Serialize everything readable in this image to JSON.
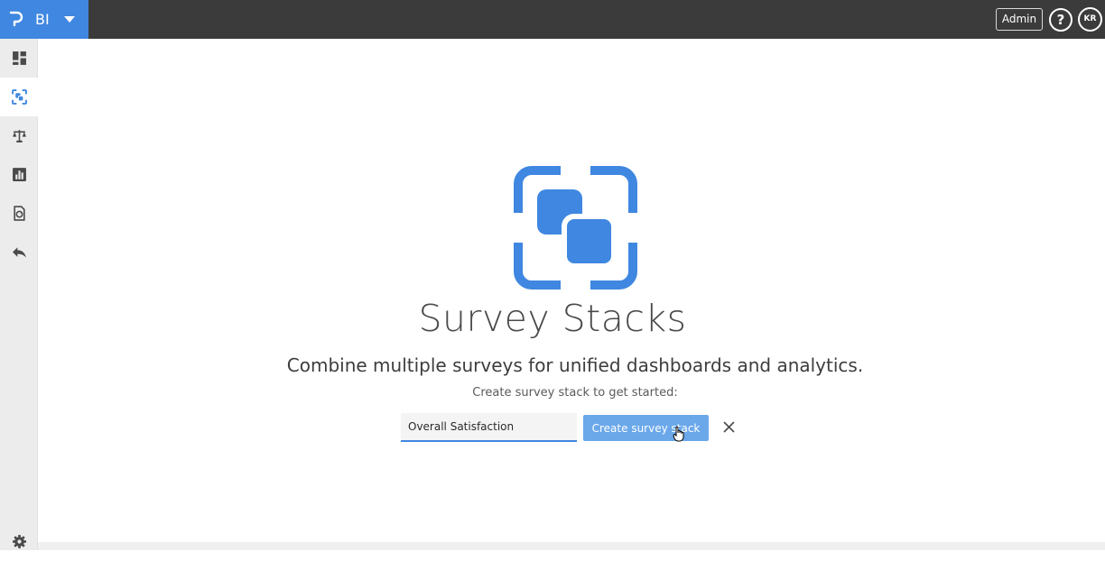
{
  "app": {
    "brand_text": "BI",
    "logo_icon": "p-logo-icon",
    "accent_color": "#3f87e0"
  },
  "topbar": {
    "admin_label": "Admin",
    "help_label": "?",
    "avatar_initials": "KR"
  },
  "sidebar": {
    "items": [
      {
        "icon": "dashboard-icon",
        "active": false
      },
      {
        "icon": "survey-stack-icon",
        "active": true
      },
      {
        "icon": "scale-icon",
        "active": false
      },
      {
        "icon": "bar-chart-icon",
        "active": false
      },
      {
        "icon": "document-refresh-icon",
        "active": false
      },
      {
        "icon": "reply-arrow-icon",
        "active": false
      },
      {
        "icon": "gear-icon",
        "active": false
      }
    ]
  },
  "main": {
    "hero_icon": "survey-stack-icon",
    "title": "Survey Stacks",
    "subtitle": "Combine multiple surveys for unified dashboards and analytics.",
    "hint": "Create survey stack to get started:",
    "input_value": "Overall Satisfaction",
    "create_button_label": "Create survey stack",
    "close_icon": "close-icon"
  }
}
